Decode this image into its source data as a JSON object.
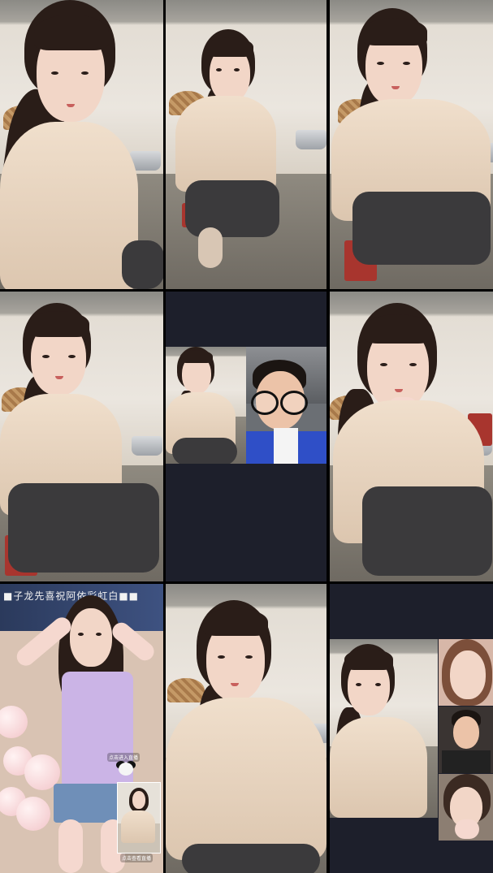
{
  "colors": {
    "background": "#000000",
    "call_panel": "#1d1f2b",
    "jacket": "#ead7c2",
    "hair": "#2a1d18",
    "boy_shirt": "#2f4fc7",
    "banner": "#2b3a5c"
  },
  "tiles": [
    {
      "name": "video-tile-1",
      "kind": "camera-feed"
    },
    {
      "name": "video-tile-2",
      "kind": "camera-feed"
    },
    {
      "name": "video-tile-3",
      "kind": "camera-feed"
    },
    {
      "name": "video-tile-4",
      "kind": "camera-feed"
    },
    {
      "name": "video-tile-5",
      "kind": "dual-call"
    },
    {
      "name": "video-tile-6",
      "kind": "camera-feed"
    },
    {
      "name": "video-tile-7",
      "kind": "stream-with-pip"
    },
    {
      "name": "video-tile-8",
      "kind": "camera-feed"
    },
    {
      "name": "video-tile-9",
      "kind": "multi-call"
    }
  ],
  "tile7": {
    "banner_text": "■子龙先喜祝阿依彩虹白■■",
    "pip_label_top": "点击进入直播",
    "pip_label_bottom": "点击查看直播"
  }
}
